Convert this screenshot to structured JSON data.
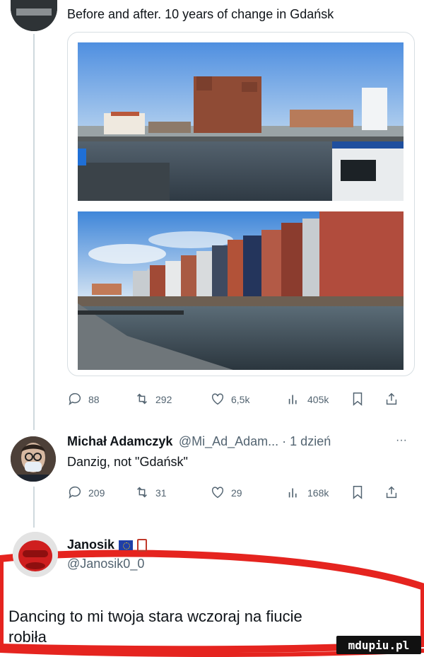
{
  "tweet1": {
    "text": "Before and after. 10 years of change in Gdańsk",
    "actions": {
      "replies": "88",
      "retweets": "292",
      "likes": "6,5k",
      "views": "405k"
    }
  },
  "reply1": {
    "name": "Michał Adamczyk",
    "handle_time": "@Mi_Ad_Adam... · 1 dzień",
    "more": "···",
    "text": "Danzig, not \"Gdańsk\"",
    "actions": {
      "replies": "209",
      "retweets": "31",
      "likes": "29",
      "views": "168k"
    }
  },
  "reply2": {
    "name": "Janosik",
    "handle": "@Janosik0_0",
    "text_line1": "Dancing to mi twoja stara wczoraj na fiucie",
    "text_line2": "robiła"
  },
  "watermark": "mdupiu.pl",
  "colors": {
    "accent_red": "#e5241f",
    "icon_gray": "#536471",
    "line_gray": "#cfd9de"
  }
}
